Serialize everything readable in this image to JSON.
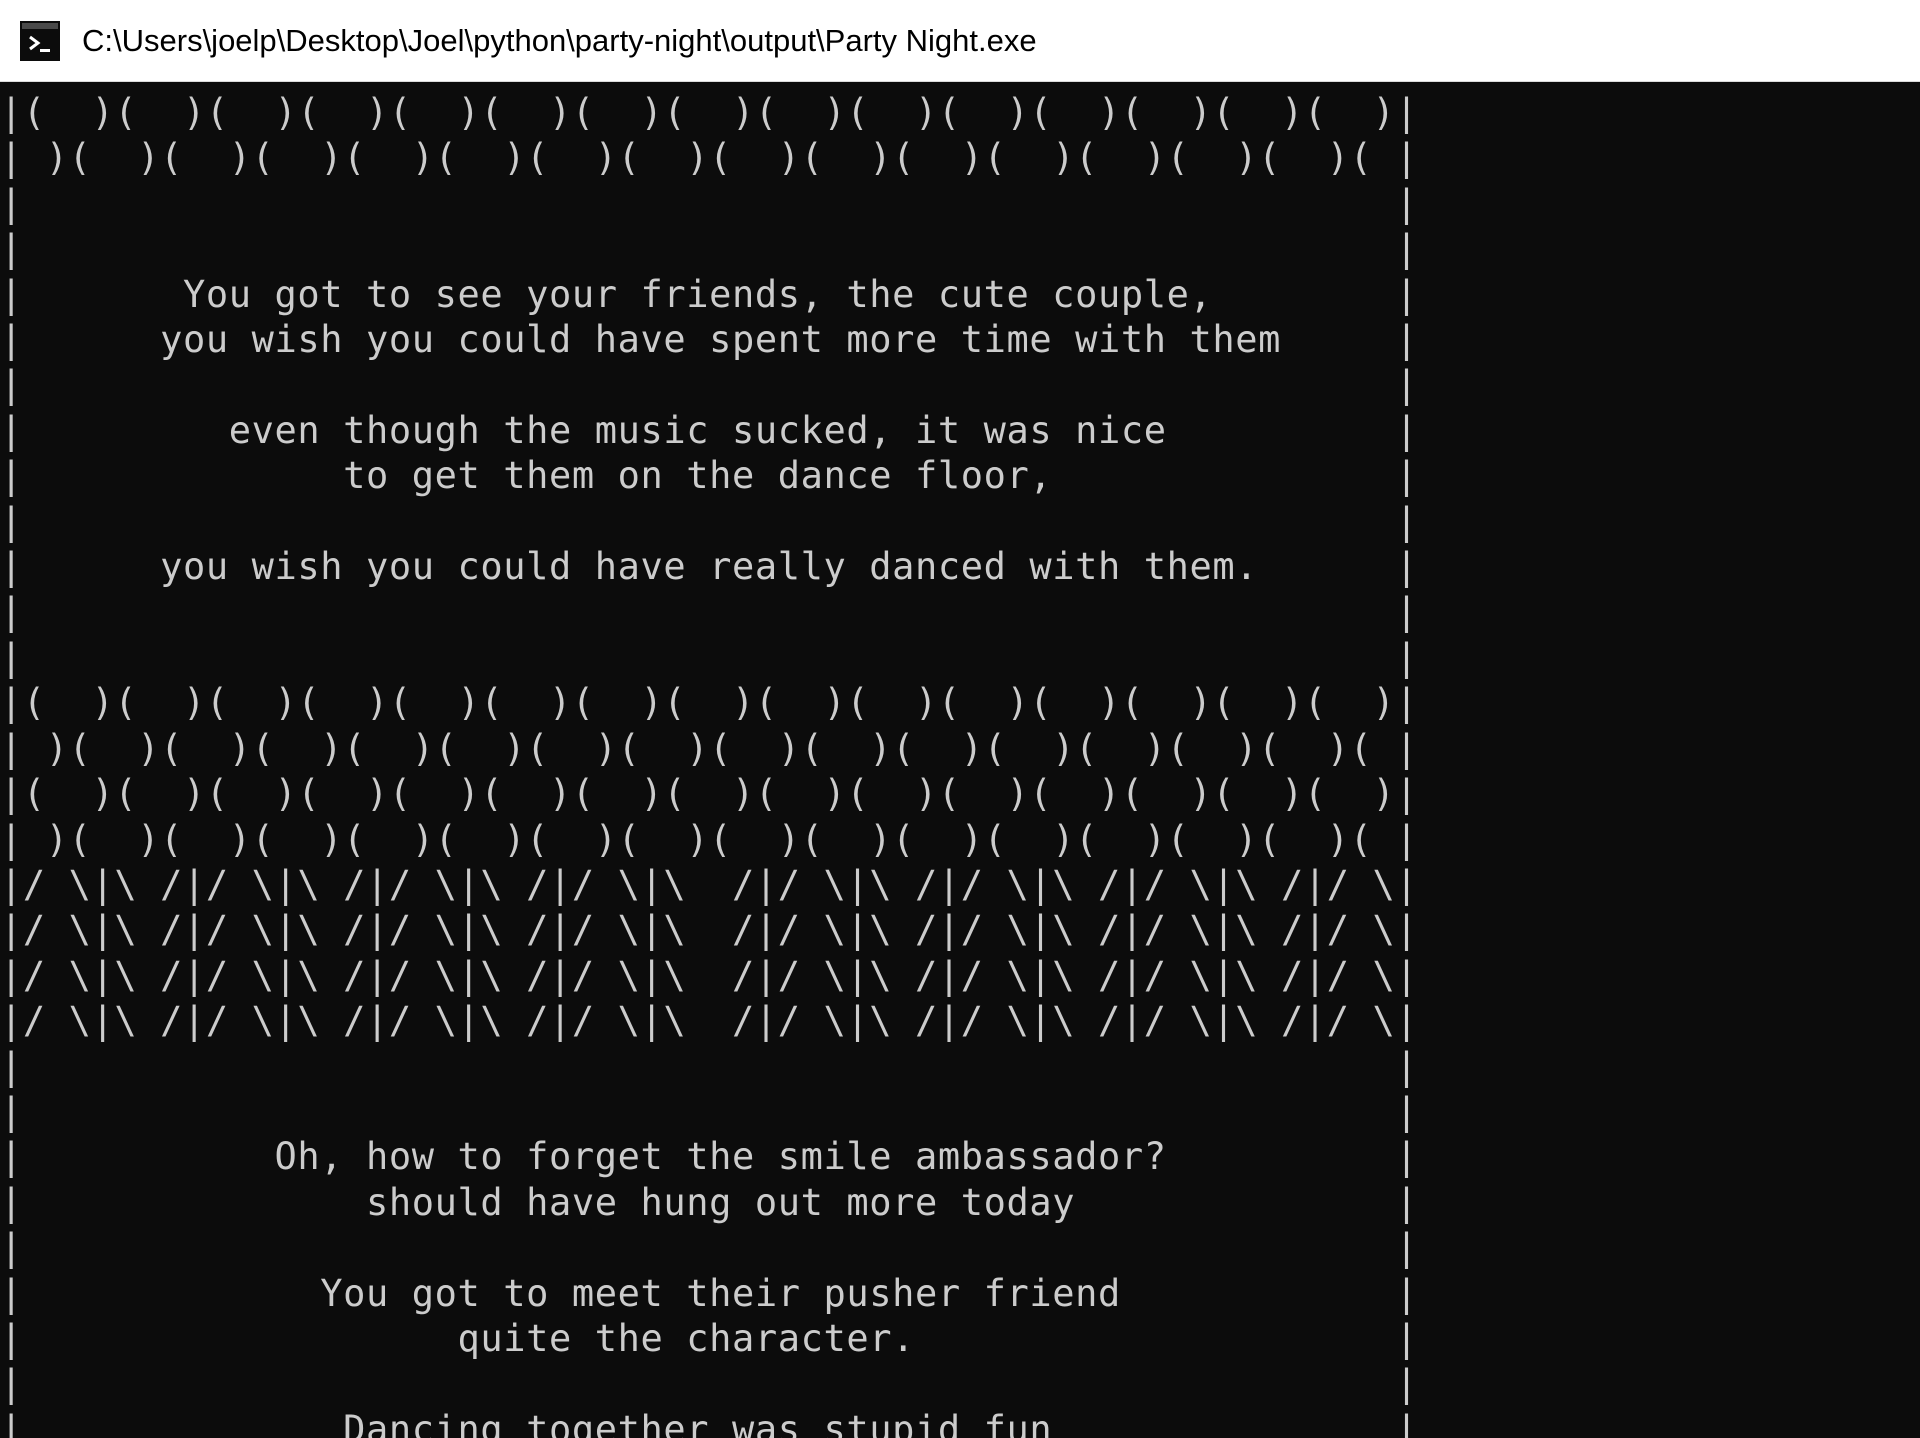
{
  "window": {
    "title": "C:\\Users\\joelp\\Desktop\\Joel\\python\\party-night\\output\\Party Night.exe",
    "icon": "console-app-icon"
  },
  "console": {
    "lines": [
      "|(  )(  )(  )(  )(  )(  )(  )(  )(  )(  )(  )(  )(  )(  )(  )|",
      "| )(  )(  )(  )(  )(  )(  )(  )(  )(  )(  )(  )(  )(  )(  )( |",
      "|                                                            |",
      "|                                                            |",
      "|       You got to see your friends, the cute couple,        |",
      "|      you wish you could have spent more time with them     |",
      "|                                                            |",
      "|         even though the music sucked, it was nice          |",
      "|              to get them on the dance floor,               |",
      "|                                                            |",
      "|      you wish you could have really danced with them.      |",
      "|                                                            |",
      "|                                                            |",
      "|(  )(  )(  )(  )(  )(  )(  )(  )(  )(  )(  )(  )(  )(  )(  )|",
      "| )(  )(  )(  )(  )(  )(  )(  )(  )(  )(  )(  )(  )(  )(  )( |",
      "|(  )(  )(  )(  )(  )(  )(  )(  )(  )(  )(  )(  )(  )(  )(  )|",
      "| )(  )(  )(  )(  )(  )(  )(  )(  )(  )(  )(  )(  )(  )(  )( |",
      "|/ \\|\\ /|/ \\|\\ /|/ \\|\\ /|/ \\|\\  /|/ \\|\\ /|/ \\|\\ /|/ \\|\\ /|/ \\|",
      "|/ \\|\\ /|/ \\|\\ /|/ \\|\\ /|/ \\|\\  /|/ \\|\\ /|/ \\|\\ /|/ \\|\\ /|/ \\|",
      "|/ \\|\\ /|/ \\|\\ /|/ \\|\\ /|/ \\|\\  /|/ \\|\\ /|/ \\|\\ /|/ \\|\\ /|/ \\|",
      "|/ \\|\\ /|/ \\|\\ /|/ \\|\\ /|/ \\|\\  /|/ \\|\\ /|/ \\|\\ /|/ \\|\\ /|/ \\|",
      "|                                                            |",
      "|                                                            |",
      "|           Oh, how to forget the smile ambassador?          |",
      "|               should have hung out more today              |",
      "|                                                            |",
      "|             You got to meet their pusher friend            |",
      "|                   quite the character.                     |",
      "|                                                            |",
      "|              Dancing together was stupid fun               |"
    ]
  }
}
